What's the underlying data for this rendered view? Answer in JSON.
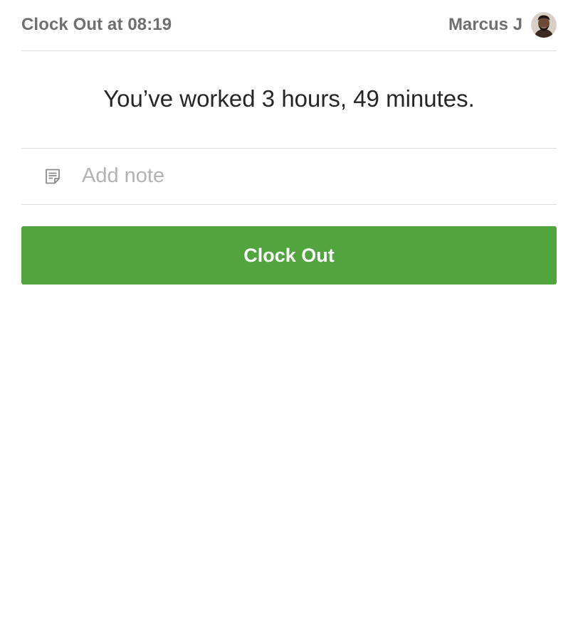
{
  "header": {
    "title": "Clock Out at 08:19",
    "user_name": "Marcus J",
    "avatar_icon": "user-avatar"
  },
  "summary": {
    "text": "You’ve worked 3 hours, 49 minutes."
  },
  "note": {
    "icon": "note-icon",
    "placeholder": "Add note",
    "value": ""
  },
  "actions": {
    "clock_out_label": "Clock Out"
  },
  "colors": {
    "accent": "#52a43f",
    "header_text": "#6f6f6f",
    "body_text": "#262626",
    "placeholder": "#b3b3b3",
    "divider": "#dcdcdc"
  }
}
